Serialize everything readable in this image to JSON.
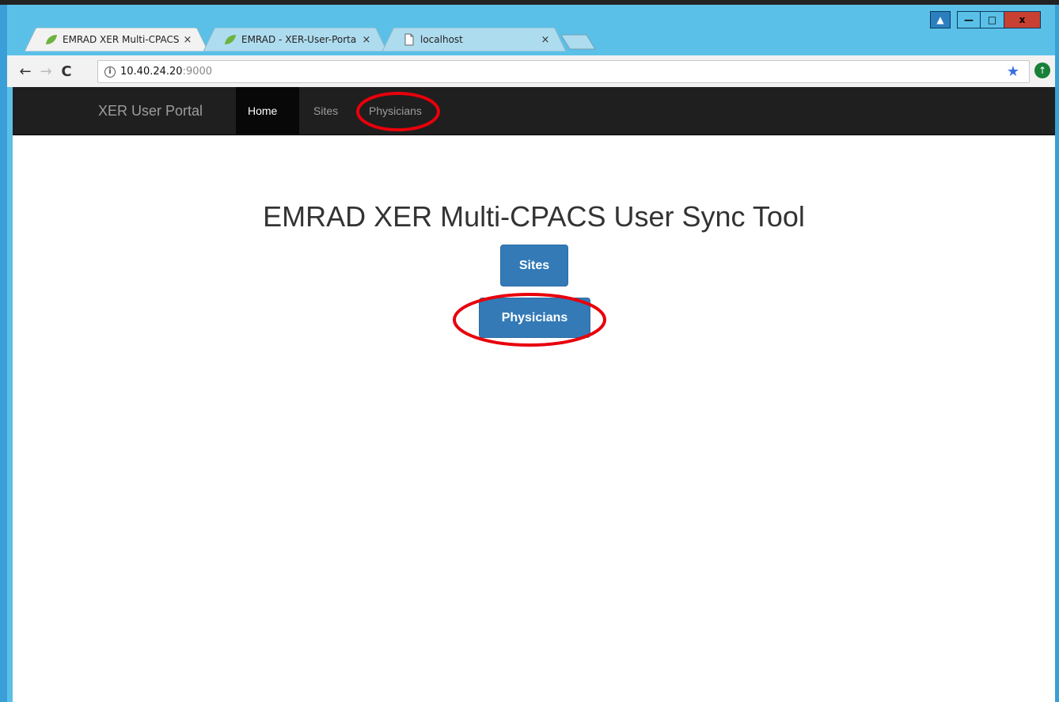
{
  "browser": {
    "tabs": [
      {
        "title": "EMRAD XER Multi-CPACS",
        "close": "×",
        "active": true,
        "favicon": "spring-leaf-icon"
      },
      {
        "title": "EMRAD - XER-User-Porta",
        "close": "×",
        "active": false,
        "favicon": "spring-leaf-icon"
      },
      {
        "title": "localhost",
        "close": "×",
        "active": false,
        "favicon": "page-icon"
      }
    ],
    "window_controls": {
      "profile": "▲",
      "minimize": "—",
      "maximize": "□",
      "close": "x"
    },
    "toolbar": {
      "back": "←",
      "forward": "→",
      "reload": "C",
      "info": "i",
      "url_host": "10.40.24.20",
      "url_port": ":9000",
      "bookmark_star": "★",
      "extension": "↑"
    }
  },
  "page": {
    "navbar": {
      "brand": "XER User Portal",
      "links": [
        "Home",
        "Sites",
        "Physicians"
      ],
      "active": "Home"
    },
    "title": "EMRAD XER Multi-CPACS User Sync Tool",
    "buttons": {
      "sites": "Sites",
      "physicians": "Physicians"
    }
  },
  "colors": {
    "annotation": "#e8000b",
    "primary_button": "#337ab7",
    "navbar_bg": "#1f1f1f",
    "window_frame": "#5bc0e8"
  }
}
